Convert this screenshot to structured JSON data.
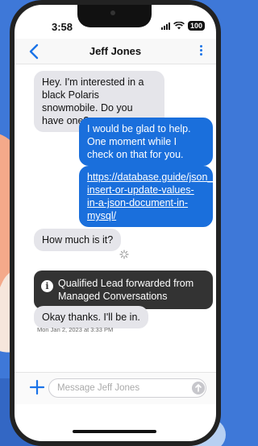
{
  "status": {
    "time": "3:58",
    "battery": "100"
  },
  "header": {
    "title": "Jeff Jones"
  },
  "messages": [
    {
      "direction": "incoming",
      "text": "Hey. I'm interested in a black Polaris snowmobile. Do you have one?"
    },
    {
      "direction": "outgoing",
      "text": "I would be glad to help. One moment while I check on that for you."
    },
    {
      "direction": "outgoing",
      "text": "https://database.guide/json_set-insert-or-update-values-in-a-json-document-in-mysql/"
    },
    {
      "direction": "incoming",
      "text": "How much is it?"
    }
  ],
  "notice": {
    "text": "Qualified Lead forwarded from Managed Conversations"
  },
  "reply": {
    "text": "Okay thanks. I'll be in.",
    "timestamp": "Mon Jan 2, 2023 at 3:33 PM"
  },
  "composer": {
    "placeholder": "Message Jeff  Jones"
  },
  "colors": {
    "accent": "#1a6fdc",
    "incoming_bubble": "#e5e5ea",
    "notice_bg": "#333333"
  }
}
